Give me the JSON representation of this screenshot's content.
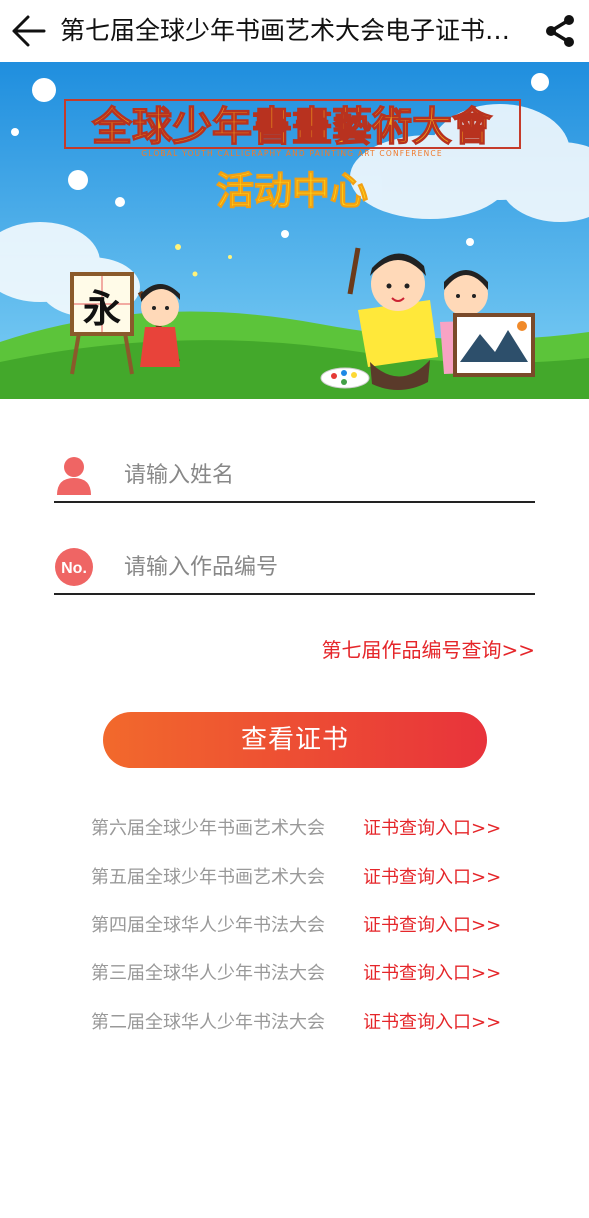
{
  "nav": {
    "title": "第七届全球少年书画艺术大会电子证书查询",
    "back_icon": "back-arrow-icon",
    "share_icon": "share-icon"
  },
  "banner": {
    "heading": "全球少年書畫藝術大會",
    "subtitle_en": "GLOBAL YOUTH CALLIGRAPHY AND PAINTING ART CONFERENCE",
    "slogan": "活动中心",
    "easel_char": "永"
  },
  "form": {
    "name_placeholder": "请输入姓名",
    "name_icon": "person-icon",
    "number_badge": "No.",
    "number_placeholder": "请输入作品编号",
    "lookup_link": "第七届作品编号查询>>",
    "submit_label": "查看证书"
  },
  "history": [
    {
      "name": "第六届全球少年书画艺术大会",
      "link": "证书查询入口>>"
    },
    {
      "name": "第五届全球少年书画艺术大会",
      "link": "证书查询入口>>"
    },
    {
      "name": "第四届全球华人少年书法大会",
      "link": "证书查询入口>>"
    },
    {
      "name": "第三届全球华人少年书法大会",
      "link": "证书查询入口>>"
    },
    {
      "name": "第二届全球华人少年书法大会",
      "link": "证书查询入口>>"
    }
  ],
  "colors": {
    "accent_red": "#e5262a",
    "button_start": "#f2692c",
    "button_end": "#e8333b",
    "icon_coral": "#ef6564",
    "sky": "#2a9be0",
    "grass": "#5cc43a"
  }
}
